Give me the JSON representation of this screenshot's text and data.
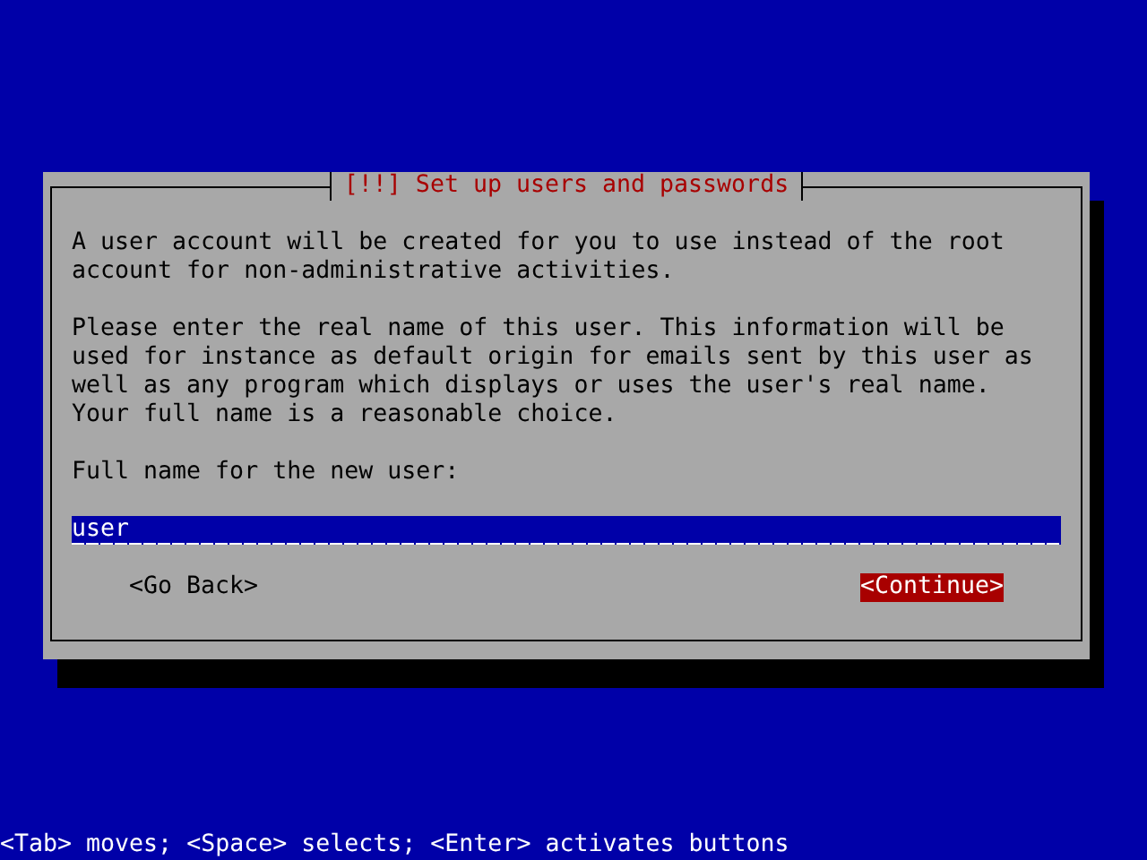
{
  "dialog": {
    "title": "[!!] Set up users and passwords",
    "paragraphs": [
      "A user account will be created for you to use instead of the root account for non-administrative activities.",
      "Please enter the real name of this user. This information will be used for instance as default origin for emails sent by this user as well as any program which displays or uses the user's real name. Your full name is a reasonable choice."
    ],
    "field_label": "Full name for the new user:",
    "field": {
      "value": "user"
    },
    "buttons": [
      {
        "label": "<Go Back>",
        "selected": false
      },
      {
        "label": "<Continue>",
        "selected": true
      }
    ]
  },
  "status_bar": "<Tab> moves; <Space> selects; <Enter> activates buttons"
}
